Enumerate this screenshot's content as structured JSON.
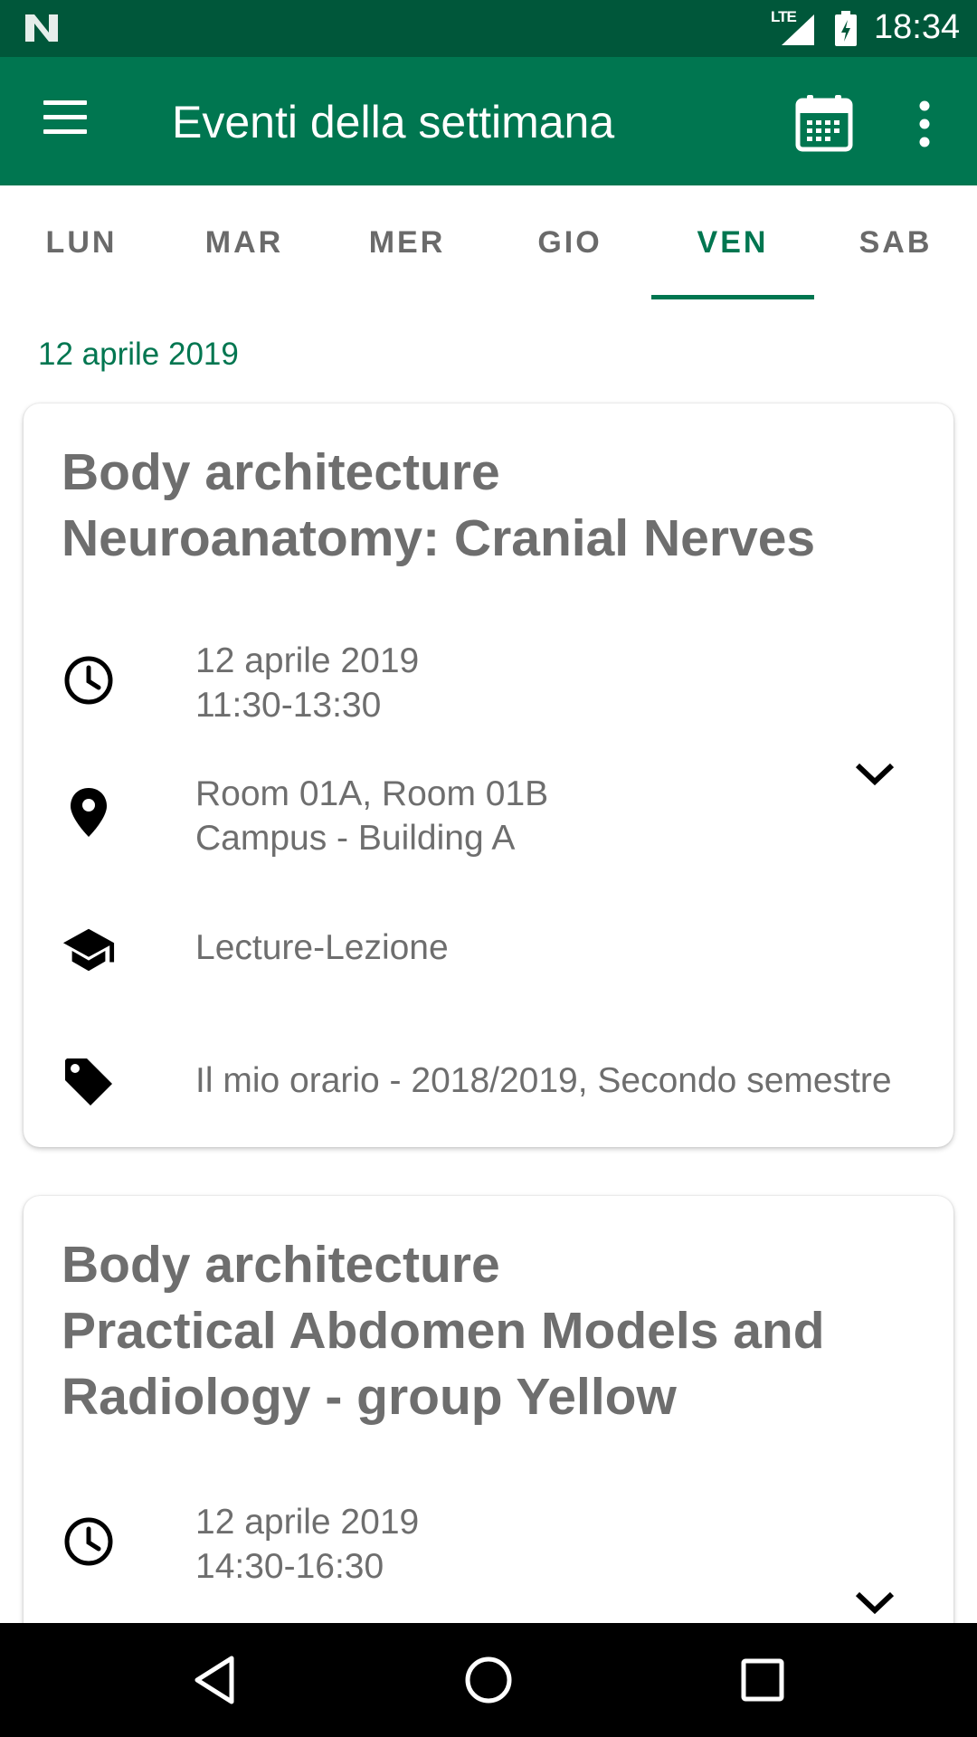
{
  "status_bar": {
    "time": "18:34",
    "network": "LTE",
    "icons": [
      "n-logo-icon",
      "signal-icon",
      "battery-icon"
    ]
  },
  "app_bar": {
    "title": "Eventi della settimana",
    "icons": [
      "menu-icon",
      "calendar-icon",
      "more-vert-icon"
    ]
  },
  "tabs": [
    {
      "label": "LUN",
      "active": false
    },
    {
      "label": "MAR",
      "active": false
    },
    {
      "label": "MER",
      "active": false
    },
    {
      "label": "GIO",
      "active": false
    },
    {
      "label": "VEN",
      "active": true
    },
    {
      "label": "SAB",
      "active": false
    }
  ],
  "date_header": "12 aprile 2019",
  "events": [
    {
      "title_line1": "Body architecture",
      "title_line2": "Neuroanatomy: Cranial Nerves",
      "date": "12 aprile 2019",
      "time": "11:30-13:30",
      "room": "Room 01A, Room 01B",
      "building": "Campus - Building A",
      "type": "Lecture-Lezione",
      "tag": "Il mio orario - 2018/2019, Secondo semestre"
    },
    {
      "title_line1": "Body architecture",
      "title_line2": "Practical Abdomen Models and",
      "title_line3": "Radiology - group Yellow",
      "date": "12 aprile 2019",
      "time": "14:30-16:30"
    }
  ],
  "colors": {
    "primary": "#007650",
    "primary_dark": "#00573a",
    "text_secondary": "#6e6e6e"
  },
  "nav_bar": {
    "icons": [
      "back-icon",
      "home-icon",
      "recents-icon"
    ]
  }
}
